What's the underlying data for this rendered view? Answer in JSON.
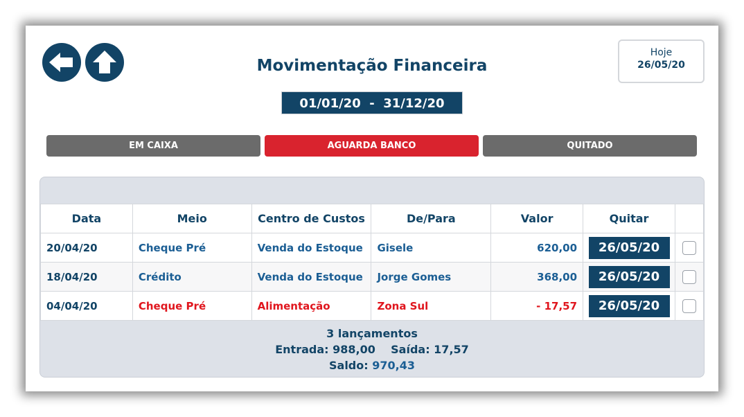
{
  "header": {
    "title": "Movimentação Financeira",
    "today_label": "Hoje",
    "today_value": "26/05/20",
    "period": "01/01/20  -  31/12/20"
  },
  "nav": {
    "back_icon": "arrow-left-icon",
    "home_icon": "arrow-up-icon"
  },
  "tabs": [
    {
      "label": "EM CAIXA",
      "color": "#6b6b6b"
    },
    {
      "label": "AGUARDA BANCO",
      "color": "#d9232e",
      "active": true
    },
    {
      "label": "QUITADO",
      "color": "#6b6b6b"
    }
  ],
  "table": {
    "columns": [
      "Data",
      "Meio",
      "Centro de Custos",
      "De/Para",
      "Valor",
      "Quitar",
      ""
    ],
    "rows": [
      {
        "data": "20/04/20",
        "meio": "Cheque Pré",
        "centro": "Venda do Estoque",
        "depara": "Gisele",
        "valor": "620,00",
        "quitar": "26/05/20"
      },
      {
        "data": "18/04/20",
        "meio": "Crédito",
        "centro": "Venda do Estoque",
        "depara": "Jorge Gomes",
        "valor": "368,00",
        "quitar": "26/05/20"
      },
      {
        "data": "04/04/20",
        "meio": "Cheque Pré",
        "centro": "Alimentação",
        "depara": "Zona Sul",
        "valor": "- 17,57",
        "quitar": "26/05/20"
      }
    ]
  },
  "summary": {
    "count": "3 lançamentos",
    "entrada_label": "Entrada:",
    "entrada_value": "988,00",
    "saida_label": "Saída:",
    "saida_value": "17,57",
    "saldo_label": "Saldo:",
    "saldo_value": "970,43"
  },
  "colors": {
    "primary": "#124466",
    "danger": "#d9232e",
    "neutral": "#6b6b6b"
  }
}
